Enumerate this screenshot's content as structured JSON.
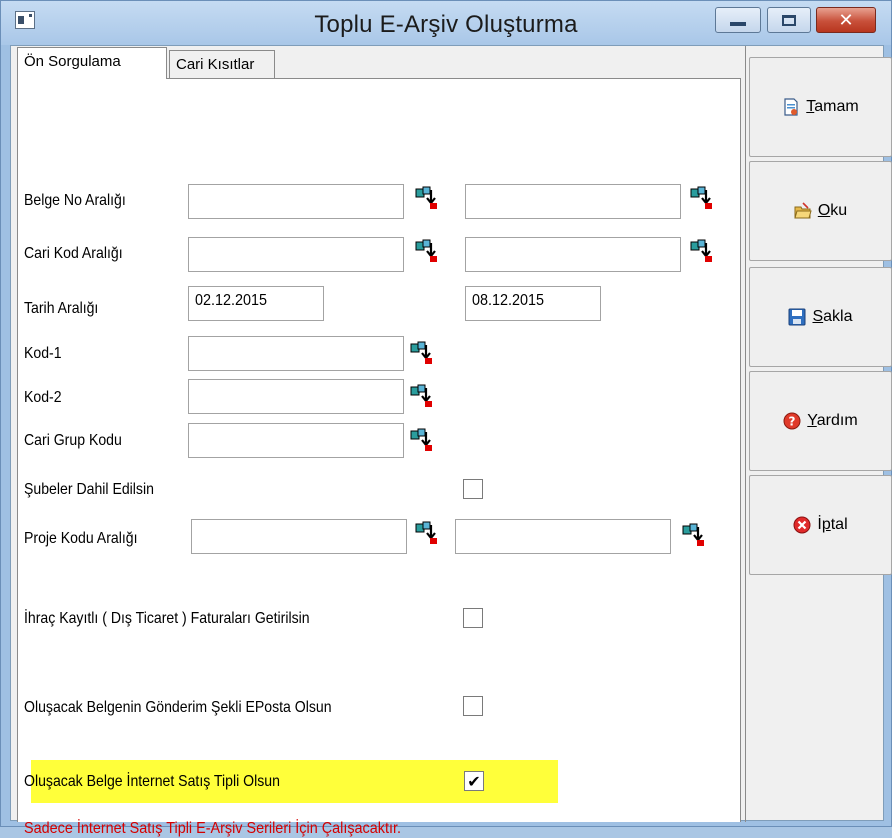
{
  "window": {
    "title": "Toplu E-Arşiv Oluşturma"
  },
  "tabs": [
    {
      "label": "Ön Sorgulama",
      "active": true
    },
    {
      "label": "Cari Kısıtlar",
      "active": false
    }
  ],
  "form": {
    "belge_no": {
      "label": "Belge No Aralığı",
      "from": "",
      "to": ""
    },
    "cari_kod": {
      "label": "Cari Kod Aralığı",
      "from": "",
      "to": ""
    },
    "tarih": {
      "label": "Tarih Aralığı",
      "from": "02.12.2015",
      "to": "08.12.2015"
    },
    "kod1": {
      "label": "Kod-1",
      "value": ""
    },
    "kod2": {
      "label": "Kod-2",
      "value": ""
    },
    "cari_grup": {
      "label": "Cari Grup Kodu",
      "value": ""
    },
    "subeler": {
      "label": "Şubeler Dahil Edilsin",
      "checked": false
    },
    "proje_kodu": {
      "label": "Proje Kodu Aralığı",
      "from": "",
      "to": ""
    },
    "ihrac": {
      "label": "İhraç Kayıtlı  ( Dış Ticaret ) Faturaları Getirilsin",
      "checked": false
    },
    "eposta": {
      "label": "Oluşacak Belgenin Gönderim Şekli EPosta Olsun",
      "checked": false
    },
    "internet": {
      "label": "Oluşacak Belge İnternet Satış Tipli Olsun",
      "checked": true,
      "highlight_color": "#ffff3a"
    },
    "note": {
      "text": "Sadece İnternet Satış Tipli E-Arşiv Serileri  İçin  Çalışacaktır.",
      "color": "#d40000"
    }
  },
  "buttons": {
    "tamam": {
      "first": "T",
      "rest": "amam",
      "icon": "document-icon"
    },
    "oku": {
      "first": "O",
      "rest": "ku",
      "icon": "open-folder-icon"
    },
    "sakla": {
      "first": "S",
      "rest": "akla",
      "icon": "save-disk-icon"
    },
    "yardim": {
      "first": "Y",
      "rest": "ardım",
      "icon": "help-icon"
    },
    "iptal": {
      "first": "İ",
      "mid": "p",
      "rest": "tal",
      "icon": "cancel-icon"
    }
  },
  "icons": {
    "lookup": "lookup-icon"
  }
}
